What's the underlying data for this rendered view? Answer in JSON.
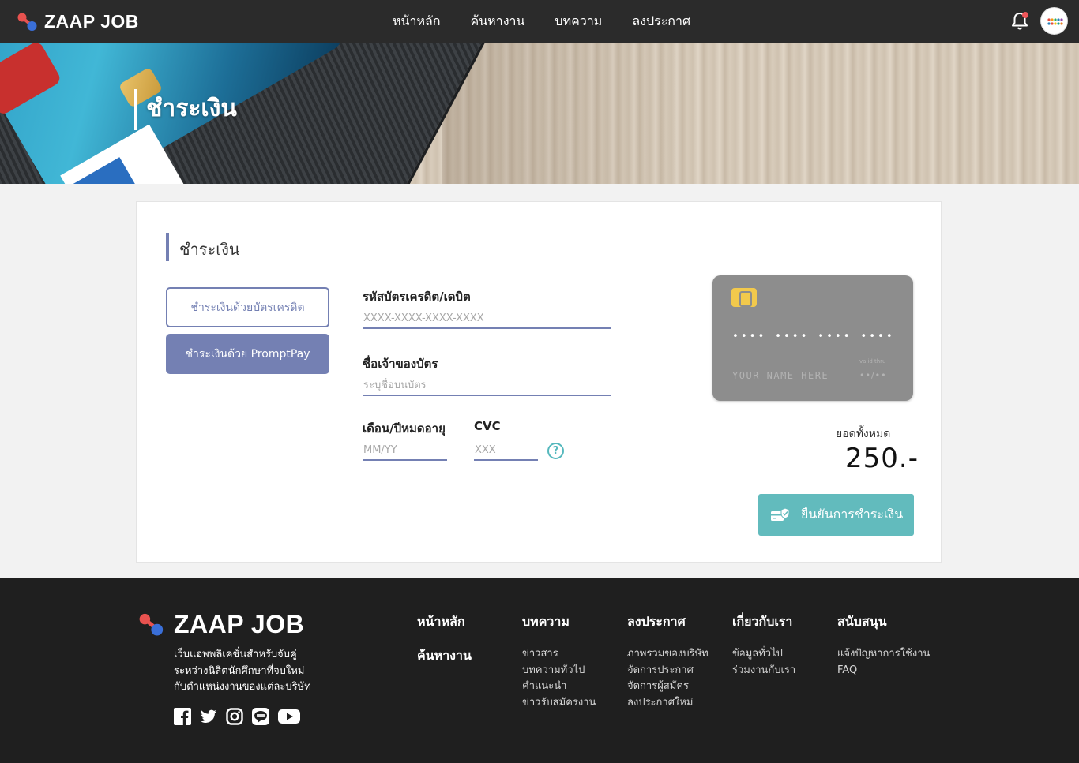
{
  "brand": {
    "name": "ZAAP JOB"
  },
  "nav": {
    "items": [
      "หน้าหลัก",
      "ค้นหางาน",
      "บทความ",
      "ลงประกาศ"
    ]
  },
  "hero": {
    "title": "ชำระเงิน"
  },
  "payment": {
    "section_title": "ชำระเงิน",
    "method_card_label": "ชำระเงินด้วยบัตรเครดิต",
    "method_promptpay_label": "ชำระเงินด้วย PromptPay",
    "card_number_label": "รหัสบัตรเครดิต/เดบิต",
    "card_number_placeholder": "XXXX-XXXX-XXXX-XXXX",
    "card_holder_label": "ชื่อเจ้าของบัตร",
    "card_holder_placeholder": "ระบุชื่อบนบัตร",
    "expiry_label": "เดือน/ปีหมดอายุ",
    "expiry_placeholder": "MM/YY",
    "cvc_label": "CVC",
    "cvc_placeholder": "XXX",
    "help_symbol": "?",
    "card_preview": {
      "number": "•••• •••• •••• ••••",
      "name": "YOUR NAME HERE",
      "valid_label": "valid thru",
      "valid_value": "••/••"
    },
    "total_label": "ยอดทั้งหมด",
    "total_amount": "250.-",
    "confirm_label": "ยืนยันการชำระเงิน"
  },
  "footer": {
    "brand": "ZAAP JOB",
    "description": [
      "เว็บแอพพลิเคชั่นสำหรับจับคู่",
      "ระหว่างนิสิตนักศึกษาที่จบใหม่",
      "กับตำแหน่งงานของแต่ละบริษัท"
    ],
    "main_links": [
      "หน้าหลัก",
      "ค้นหางาน"
    ],
    "columns": [
      {
        "heading": "บทความ",
        "links": [
          "ข่าวสาร",
          "บทความทั่วไป",
          "คำแนะนำ",
          "ข่าวรับสมัครงาน"
        ]
      },
      {
        "heading": "ลงประกาศ",
        "links": [
          "ภาพรวมของบริษัท",
          "จัดการประกาศ",
          "จัดการผู้สมัคร",
          "ลงประกาศใหม่"
        ]
      },
      {
        "heading": "เกี่ยวกับเรา",
        "links": [
          "ข้อมูลทั่วไป",
          "ร่วมงานกับเรา"
        ]
      },
      {
        "heading": "สนับสนุน",
        "links": [
          "แจ้งปัญหาการใช้งาน",
          "FAQ"
        ]
      }
    ],
    "socials": [
      "facebook-icon",
      "twitter-icon",
      "instagram-icon",
      "line-icon",
      "youtube-icon"
    ]
  },
  "colors": {
    "accent": "#7480b3",
    "confirm": "#62bbbd",
    "nav_bg": "#2b2b2b",
    "footer_bg": "#1f1f1f"
  }
}
